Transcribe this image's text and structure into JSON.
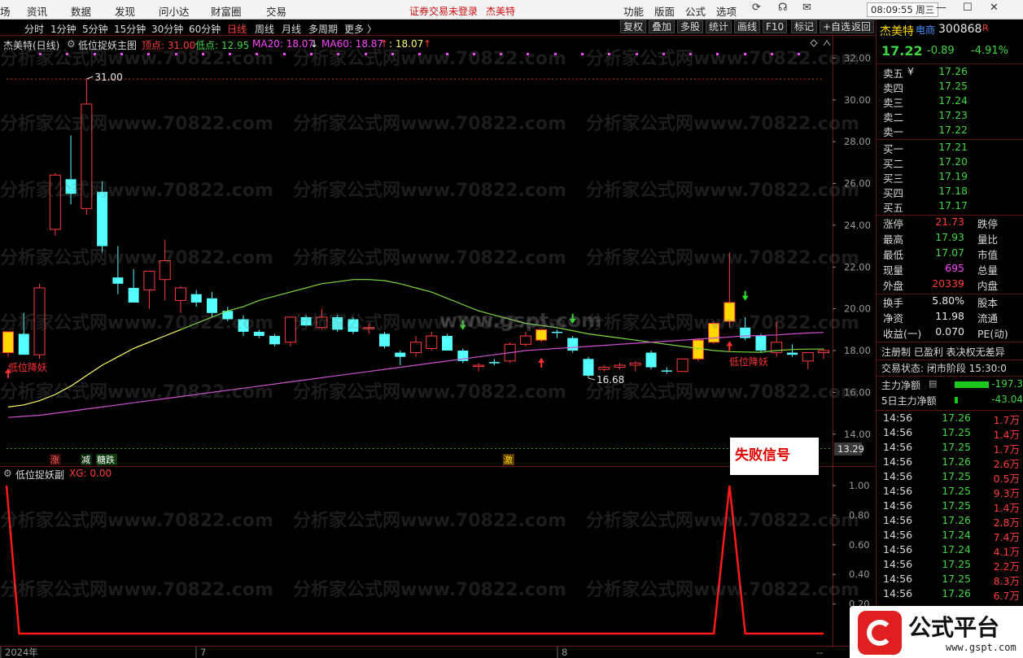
{
  "menubar": {
    "items": [
      "场",
      "资讯",
      "数据",
      "发现",
      "问小达",
      "财富圈",
      "交易"
    ],
    "notice": "证券交易未登录",
    "stock_name": "杰美特",
    "right_items": [
      "功能",
      "版面",
      "公式",
      "选项"
    ],
    "clock": "08:09:55 周三"
  },
  "toolbar": {
    "periods": [
      "分时",
      "1分钟",
      "5分钟",
      "15分钟",
      "30分钟",
      "60分钟",
      "日线",
      "周线",
      "月线",
      "多周期",
      "更多 〉"
    ],
    "active_period": "日线",
    "buttons": [
      "复权",
      "叠加",
      "多股",
      "统计",
      "画线",
      "F10",
      "标记",
      "返回"
    ]
  },
  "main_legend": {
    "stock": "杰美特(日线)",
    "formula": "低位捉妖主图",
    "top_label": "顶点: 31.00",
    "low_label": "低点: 12.95",
    "ma20_label": "MA20: 18.07",
    "ma60_label": "MA60: 18.87",
    "extra_label": ": 18.07"
  },
  "sub_legend": {
    "formula": "低位捉妖副",
    "xg_label": "XG: 0.00"
  },
  "price_axis": [
    "32.00",
    "30.00",
    "28.00",
    "26.00",
    "24.00",
    "22.00",
    "20.00",
    "18.00",
    "16.00",
    "14.00"
  ],
  "price_marker": "13.29",
  "sub_axis": [
    "1.00",
    "0.80",
    "0.60",
    "0.40",
    "0.20"
  ],
  "date_axis": [
    "2024年",
    "7",
    "8"
  ],
  "date_axis_end": "--",
  "annotations": {
    "high_label": "31.00",
    "low_label": "16.68",
    "signal_left": "低位降妖",
    "signal_right": "低位降妖",
    "tag_zhang": "涨",
    "tag_jian": "减",
    "tag_jiedie": "糖跌",
    "tag_ji": "激",
    "fail_signal": "失败信号",
    "watermark_site": "www.gspt.com",
    "watermark_repeat": "分析家公式网www.70822.com"
  },
  "panel": {
    "title": "杰美特",
    "sector": "电商",
    "code": "300868",
    "code_suffix": "R",
    "price": "17.22",
    "change": "-0.89",
    "change_pct": "-4.91%",
    "sell": [
      {
        "label": "卖五",
        "mark": "¥",
        "price": "17.26"
      },
      {
        "label": "卖四",
        "mark": "",
        "price": "17.25"
      },
      {
        "label": "卖三",
        "mark": "",
        "price": "17.24"
      },
      {
        "label": "卖二",
        "mark": "",
        "price": "17.23"
      },
      {
        "label": "卖一",
        "mark": "",
        "price": "17.22"
      }
    ],
    "buy": [
      {
        "label": "买一",
        "price": "17.21"
      },
      {
        "label": "买二",
        "price": "17.20"
      },
      {
        "label": "买三",
        "price": "17.19"
      },
      {
        "label": "买四",
        "price": "17.18"
      },
      {
        "label": "买五",
        "price": "17.17"
      }
    ],
    "stats": [
      {
        "l1": "涨停",
        "v1": "21.73",
        "c1": "red",
        "l2": "跌停"
      },
      {
        "l1": "最高",
        "v1": "17.93",
        "c1": "green",
        "l2": "量比"
      },
      {
        "l1": "最低",
        "v1": "17.07",
        "c1": "green",
        "l2": "市值"
      },
      {
        "l1": "现量",
        "v1": "695",
        "c1": "mag",
        "l2": "总量"
      },
      {
        "l1": "外盘",
        "v1": "20339",
        "c1": "red",
        "l2": "内盘"
      }
    ],
    "stats2": [
      {
        "l1": "换手",
        "v1": "5.80%",
        "l2": "股本"
      },
      {
        "l1": "净资",
        "v1": "11.98",
        "l2": "流通"
      },
      {
        "l1": "收益(一)",
        "v1": "0.070",
        "l2": "PE(动)"
      }
    ],
    "status_line": "注册制 已盈利 表决权无差异",
    "trade_state": "交易状态: 闭市阶段 15:30:0",
    "main_net_label": "主力净额",
    "main_net_value": "-197.3",
    "net5_label": "5日主力净额",
    "net5_value": "-43.04",
    "ticks": [
      {
        "time": "14:56",
        "price": "17.26",
        "vol": "1.7万"
      },
      {
        "time": "14:56",
        "price": "17.25",
        "vol": "1.4万"
      },
      {
        "time": "14:56",
        "price": "17.25",
        "vol": "1.7万"
      },
      {
        "time": "14:56",
        "price": "17.26",
        "vol": "2.6万"
      },
      {
        "time": "14:56",
        "price": "17.25",
        "vol": "0.5万"
      },
      {
        "time": "14:56",
        "price": "17.25",
        "vol": "9.3万"
      },
      {
        "time": "14:56",
        "price": "17.25",
        "vol": "1.4万"
      },
      {
        "time": "14:56",
        "price": "17.26",
        "vol": "2.8万"
      },
      {
        "time": "14:56",
        "price": "17.24",
        "vol": "7.4万"
      },
      {
        "time": "14:56",
        "price": "17.24",
        "vol": "4.1万"
      },
      {
        "time": "14:56",
        "price": "17.25",
        "vol": "2.2万"
      },
      {
        "time": "14:56",
        "price": "17.25",
        "vol": "8.3万"
      },
      {
        "time": "14:56",
        "price": "17.26",
        "vol": "6.7万"
      }
    ]
  },
  "logo": {
    "brand": "公式平台",
    "site": "www.gspt.com"
  },
  "colors": {
    "up": "#ff3b3b",
    "down": "#54ffff",
    "ma20": "#ffff66",
    "ma60": "#d050d0",
    "xg": "#ff1a1a"
  },
  "chart_data": {
    "type": "candlestick",
    "price_range": [
      13.29,
      32.6
    ],
    "candles": [
      {
        "o": 17.9,
        "h": 18.9,
        "l": 17.7,
        "c": 18.9,
        "t": "yellow"
      },
      {
        "o": 18.8,
        "h": 19.8,
        "l": 17.9,
        "c": 17.8,
        "t": "down"
      },
      {
        "o": 17.8,
        "h": 21.2,
        "l": 17.6,
        "c": 21.0,
        "t": "up"
      },
      {
        "o": 23.8,
        "h": 26.5,
        "l": 23.5,
        "c": 26.4,
        "t": "up"
      },
      {
        "o": 26.2,
        "h": 28.3,
        "l": 25.0,
        "c": 25.5,
        "t": "down"
      },
      {
        "o": 24.8,
        "h": 31.0,
        "l": 24.5,
        "c": 29.8,
        "t": "up"
      },
      {
        "o": 25.6,
        "h": 26.1,
        "l": 22.7,
        "c": 23.0,
        "t": "down"
      },
      {
        "o": 21.5,
        "h": 23.0,
        "l": 20.7,
        "c": 21.2,
        "t": "down"
      },
      {
        "o": 21.0,
        "h": 21.9,
        "l": 20.3,
        "c": 20.3,
        "t": "down"
      },
      {
        "o": 20.9,
        "h": 21.8,
        "l": 20.0,
        "c": 21.8,
        "t": "up"
      },
      {
        "o": 21.4,
        "h": 23.3,
        "l": 20.4,
        "c": 22.3,
        "t": "up"
      },
      {
        "o": 20.4,
        "h": 21.1,
        "l": 19.8,
        "c": 21.0,
        "t": "up"
      },
      {
        "o": 20.7,
        "h": 20.9,
        "l": 20.1,
        "c": 20.3,
        "t": "down"
      },
      {
        "o": 20.5,
        "h": 20.8,
        "l": 19.6,
        "c": 19.8,
        "t": "down"
      },
      {
        "o": 19.9,
        "h": 20.1,
        "l": 19.4,
        "c": 19.5,
        "t": "down"
      },
      {
        "o": 19.5,
        "h": 19.7,
        "l": 18.7,
        "c": 18.9,
        "t": "down"
      },
      {
        "o": 18.9,
        "h": 19.0,
        "l": 18.6,
        "c": 18.7,
        "t": "down"
      },
      {
        "o": 18.7,
        "h": 18.8,
        "l": 18.2,
        "c": 18.3,
        "t": "down"
      },
      {
        "o": 18.4,
        "h": 19.6,
        "l": 18.2,
        "c": 19.6,
        "t": "up"
      },
      {
        "o": 19.6,
        "h": 19.7,
        "l": 19.2,
        "c": 19.2,
        "t": "down"
      },
      {
        "o": 19.1,
        "h": 20.0,
        "l": 19.0,
        "c": 19.6,
        "t": "up"
      },
      {
        "o": 19.6,
        "h": 19.7,
        "l": 18.9,
        "c": 19.0,
        "t": "down"
      },
      {
        "o": 19.5,
        "h": 19.6,
        "l": 18.8,
        "c": 18.9,
        "t": "down"
      },
      {
        "o": 19.1,
        "h": 19.3,
        "l": 18.8,
        "c": 19.1,
        "t": "up"
      },
      {
        "o": 18.8,
        "h": 18.9,
        "l": 18.1,
        "c": 18.2,
        "t": "down"
      },
      {
        "o": 17.9,
        "h": 18.0,
        "l": 17.3,
        "c": 17.7,
        "t": "down"
      },
      {
        "o": 17.9,
        "h": 18.7,
        "l": 17.7,
        "c": 18.4,
        "t": "up"
      },
      {
        "o": 18.1,
        "h": 18.9,
        "l": 18.0,
        "c": 18.7,
        "t": "up"
      },
      {
        "o": 18.7,
        "h": 18.8,
        "l": 18.0,
        "c": 18.0,
        "t": "down"
      },
      {
        "o": 18.0,
        "h": 18.1,
        "l": 17.4,
        "c": 17.5,
        "t": "down"
      },
      {
        "o": 17.3,
        "h": 17.4,
        "l": 17.0,
        "c": 17.3,
        "t": "up"
      },
      {
        "o": 17.4,
        "h": 17.6,
        "l": 17.3,
        "c": 17.45,
        "t": "down"
      },
      {
        "o": 17.5,
        "h": 18.4,
        "l": 17.4,
        "c": 18.3,
        "t": "up"
      },
      {
        "o": 18.3,
        "h": 18.9,
        "l": 18.2,
        "c": 18.7,
        "t": "up"
      },
      {
        "o": 18.5,
        "h": 19.0,
        "l": 18.4,
        "c": 19.0,
        "t": "yellow"
      },
      {
        "o": 18.9,
        "h": 19.0,
        "l": 18.6,
        "c": 18.85,
        "t": "down"
      },
      {
        "o": 18.6,
        "h": 18.7,
        "l": 17.9,
        "c": 18.0,
        "t": "down"
      },
      {
        "o": 17.6,
        "h": 17.7,
        "l": 16.68,
        "c": 16.8,
        "t": "down"
      },
      {
        "o": 17.1,
        "h": 17.3,
        "l": 17.0,
        "c": 17.2,
        "t": "up"
      },
      {
        "o": 17.2,
        "h": 17.4,
        "l": 17.1,
        "c": 17.3,
        "t": "up"
      },
      {
        "o": 17.3,
        "h": 17.5,
        "l": 17.0,
        "c": 17.4,
        "t": "up"
      },
      {
        "o": 17.9,
        "h": 18.0,
        "l": 17.1,
        "c": 17.2,
        "t": "down"
      },
      {
        "o": 17.0,
        "h": 17.2,
        "l": 16.9,
        "c": 17.05,
        "t": "down"
      },
      {
        "o": 17.0,
        "h": 17.6,
        "l": 17.0,
        "c": 17.6,
        "t": "up"
      },
      {
        "o": 17.6,
        "h": 18.6,
        "l": 17.5,
        "c": 18.5,
        "t": "yellow"
      },
      {
        "o": 18.4,
        "h": 19.4,
        "l": 18.3,
        "c": 19.3,
        "t": "yellow"
      },
      {
        "o": 19.4,
        "h": 22.7,
        "l": 19.1,
        "c": 20.3,
        "t": "yellow"
      },
      {
        "o": 19.1,
        "h": 19.6,
        "l": 18.5,
        "c": 18.6,
        "t": "down"
      },
      {
        "o": 18.7,
        "h": 18.8,
        "l": 17.9,
        "c": 18.0,
        "t": "down"
      },
      {
        "o": 17.9,
        "h": 19.4,
        "l": 17.7,
        "c": 18.4,
        "t": "up"
      },
      {
        "o": 17.9,
        "h": 18.3,
        "l": 17.7,
        "c": 17.8,
        "t": "down"
      },
      {
        "o": 17.5,
        "h": 17.9,
        "l": 17.1,
        "c": 17.9,
        "t": "up"
      },
      {
        "o": 17.9,
        "h": 18.1,
        "l": 17.6,
        "c": 18.0,
        "t": "up"
      }
    ],
    "ma20": [
      15.3,
      15.4,
      15.6,
      15.9,
      16.3,
      16.8,
      17.3,
      17.7,
      18.1,
      18.4,
      18.7,
      19.0,
      19.3,
      19.6,
      19.9,
      20.1,
      20.4,
      20.6,
      20.8,
      21.0,
      21.2,
      21.3,
      21.4,
      21.4,
      21.35,
      21.2,
      21.0,
      20.8,
      20.5,
      20.2,
      19.9,
      19.7,
      19.5,
      19.3,
      19.2,
      19.1,
      18.95,
      18.8,
      18.7,
      18.6,
      18.5,
      18.4,
      18.3,
      18.2,
      18.1,
      18.0,
      17.95,
      17.93,
      17.92,
      18.0,
      18.05,
      18.07,
      18.07
    ],
    "ma60": [
      14.8,
      14.85,
      14.9,
      15.0,
      15.1,
      15.2,
      15.3,
      15.4,
      15.5,
      15.6,
      15.7,
      15.8,
      15.9,
      16.0,
      16.1,
      16.2,
      16.3,
      16.4,
      16.5,
      16.6,
      16.7,
      16.8,
      16.9,
      17.0,
      17.1,
      17.2,
      17.3,
      17.4,
      17.5,
      17.6,
      17.7,
      17.8,
      17.9,
      18.0,
      18.05,
      18.1,
      18.15,
      18.2,
      18.25,
      18.3,
      18.35,
      18.4,
      18.45,
      18.5,
      18.55,
      18.6,
      18.65,
      18.7,
      18.72,
      18.75,
      18.8,
      18.84,
      18.87
    ],
    "xg": [
      1,
      0,
      0,
      0,
      0,
      0,
      0,
      0,
      0,
      0,
      0,
      0,
      0,
      0,
      0,
      0,
      0,
      0,
      0,
      0,
      0,
      0,
      0,
      0,
      0,
      0,
      0,
      0,
      0,
      0,
      0,
      0,
      0,
      0,
      0,
      0,
      0,
      0,
      0,
      0,
      0,
      0,
      0,
      0,
      0,
      0,
      1,
      0,
      0,
      0,
      0,
      0,
      0
    ],
    "xg_range": [
      0,
      1
    ]
  }
}
